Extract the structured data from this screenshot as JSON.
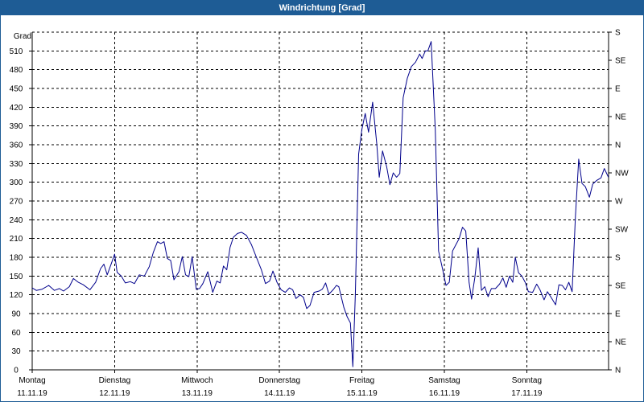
{
  "window": {
    "title": "Windrichtung [Grad]"
  },
  "colors": {
    "titlebar": "#1e5c95",
    "line": "#00008b",
    "grid": "#000000",
    "axis": "#000000"
  },
  "chart_data": {
    "type": "line",
    "title": "Windrichtung [Grad]",
    "ylabel": "Grad",
    "xlabel": "",
    "ylim": [
      0,
      540
    ],
    "yticks": [
      0,
      30,
      60,
      90,
      120,
      150,
      180,
      210,
      240,
      270,
      300,
      330,
      360,
      390,
      420,
      450,
      480,
      510
    ],
    "y2_ticks": [
      {
        "value": 0,
        "label": "N"
      },
      {
        "value": 45,
        "label": "NE"
      },
      {
        "value": 90,
        "label": "E"
      },
      {
        "value": 135,
        "label": "SE"
      },
      {
        "value": 180,
        "label": "S"
      },
      {
        "value": 225,
        "label": "SW"
      },
      {
        "value": 270,
        "label": "W"
      },
      {
        "value": 315,
        "label": "NW"
      },
      {
        "value": 360,
        "label": "N"
      },
      {
        "value": 405,
        "label": "NE"
      },
      {
        "value": 450,
        "label": "E"
      },
      {
        "value": 495,
        "label": "SE"
      },
      {
        "value": 540,
        "label": "S"
      }
    ],
    "xlim": [
      0,
      7.0
    ],
    "x_unit": "days from Monday 11.11.19 00:00",
    "days": [
      {
        "name": "Montag",
        "date": "11.11.19"
      },
      {
        "name": "Dienstag",
        "date": "12.11.19"
      },
      {
        "name": "Mittwoch",
        "date": "13.11.19"
      },
      {
        "name": "Donnerstag",
        "date": "14.11.19"
      },
      {
        "name": "Freitag",
        "date": "15.11.19"
      },
      {
        "name": "Samstag",
        "date": "16.11.19"
      },
      {
        "name": "Sonntag",
        "date": "17.11.19"
      }
    ],
    "grid": true,
    "series": [
      {
        "name": "",
        "points": [
          [
            0.0,
            131
          ],
          [
            0.05,
            127
          ],
          [
            0.12,
            129
          ],
          [
            0.2,
            135
          ],
          [
            0.27,
            127
          ],
          [
            0.33,
            130
          ],
          [
            0.38,
            126
          ],
          [
            0.45,
            133
          ],
          [
            0.5,
            146
          ],
          [
            0.56,
            140
          ],
          [
            0.62,
            136
          ],
          [
            0.7,
            128
          ],
          [
            0.77,
            140
          ],
          [
            0.83,
            162
          ],
          [
            0.87,
            169
          ],
          [
            0.91,
            152
          ],
          [
            0.96,
            170
          ],
          [
            1.0,
            185
          ],
          [
            1.03,
            156
          ],
          [
            1.08,
            150
          ],
          [
            1.13,
            139
          ],
          [
            1.19,
            141
          ],
          [
            1.24,
            138
          ],
          [
            1.3,
            152
          ],
          [
            1.36,
            150
          ],
          [
            1.42,
            165
          ],
          [
            1.47,
            188
          ],
          [
            1.52,
            205
          ],
          [
            1.56,
            202
          ],
          [
            1.6,
            205
          ],
          [
            1.64,
            178
          ],
          [
            1.68,
            175
          ],
          [
            1.72,
            144
          ],
          [
            1.78,
            157
          ],
          [
            1.82,
            181
          ],
          [
            1.86,
            152
          ],
          [
            1.9,
            149
          ],
          [
            1.94,
            181
          ],
          [
            1.99,
            129
          ],
          [
            2.03,
            130
          ],
          [
            2.07,
            138
          ],
          [
            2.13,
            157
          ],
          [
            2.19,
            124
          ],
          [
            2.24,
            142
          ],
          [
            2.28,
            139
          ],
          [
            2.32,
            166
          ],
          [
            2.36,
            160
          ],
          [
            2.4,
            196
          ],
          [
            2.44,
            212
          ],
          [
            2.49,
            218
          ],
          [
            2.54,
            220
          ],
          [
            2.6,
            215
          ],
          [
            2.66,
            200
          ],
          [
            2.72,
            180
          ],
          [
            2.78,
            160
          ],
          [
            2.83,
            138
          ],
          [
            2.88,
            142
          ],
          [
            2.92,
            158
          ],
          [
            2.97,
            140
          ],
          [
            3.02,
            128
          ],
          [
            3.07,
            124
          ],
          [
            3.12,
            131
          ],
          [
            3.16,
            128
          ],
          [
            3.2,
            114
          ],
          [
            3.25,
            120
          ],
          [
            3.29,
            116
          ],
          [
            3.33,
            98
          ],
          [
            3.37,
            103
          ],
          [
            3.42,
            124
          ],
          [
            3.48,
            126
          ],
          [
            3.52,
            129
          ],
          [
            3.56,
            139
          ],
          [
            3.6,
            121
          ],
          [
            3.65,
            128
          ],
          [
            3.69,
            135
          ],
          [
            3.72,
            133
          ],
          [
            3.78,
            100
          ],
          [
            3.82,
            85
          ],
          [
            3.86,
            75
          ],
          [
            3.89,
            5
          ],
          [
            3.92,
            120
          ],
          [
            3.96,
            345
          ],
          [
            4.0,
            385
          ],
          [
            4.04,
            410
          ],
          [
            4.08,
            380
          ],
          [
            4.13,
            428
          ],
          [
            4.18,
            362
          ],
          [
            4.21,
            308
          ],
          [
            4.25,
            350
          ],
          [
            4.3,
            325
          ],
          [
            4.34,
            296
          ],
          [
            4.38,
            315
          ],
          [
            4.42,
            308
          ],
          [
            4.46,
            314
          ],
          [
            4.5,
            435
          ],
          [
            4.55,
            466
          ],
          [
            4.6,
            485
          ],
          [
            4.65,
            492
          ],
          [
            4.7,
            505
          ],
          [
            4.73,
            498
          ],
          [
            4.77,
            510
          ],
          [
            4.8,
            510
          ],
          [
            4.84,
            525
          ],
          [
            4.89,
            385
          ],
          [
            4.93,
            190
          ],
          [
            4.98,
            160
          ],
          [
            5.02,
            135
          ],
          [
            5.06,
            140
          ],
          [
            5.1,
            190
          ],
          [
            5.14,
            200
          ],
          [
            5.18,
            210
          ],
          [
            5.22,
            228
          ],
          [
            5.26,
            222
          ],
          [
            5.3,
            140
          ],
          [
            5.33,
            113
          ],
          [
            5.37,
            148
          ],
          [
            5.41,
            195
          ],
          [
            5.45,
            127
          ],
          [
            5.49,
            133
          ],
          [
            5.53,
            117
          ],
          [
            5.57,
            130
          ],
          [
            5.62,
            130
          ],
          [
            5.67,
            137
          ],
          [
            5.71,
            147
          ],
          [
            5.75,
            132
          ],
          [
            5.79,
            150
          ],
          [
            5.83,
            140
          ],
          [
            5.86,
            180
          ],
          [
            5.9,
            155
          ],
          [
            5.94,
            150
          ],
          [
            5.98,
            140
          ],
          [
            6.02,
            125
          ],
          [
            6.07,
            124
          ],
          [
            6.12,
            137
          ],
          [
            6.16,
            128
          ],
          [
            6.21,
            112
          ],
          [
            6.25,
            125
          ],
          [
            6.3,
            115
          ],
          [
            6.35,
            104
          ],
          [
            6.39,
            136
          ],
          [
            6.43,
            135
          ],
          [
            6.47,
            128
          ],
          [
            6.51,
            140
          ],
          [
            6.55,
            125
          ],
          [
            6.59,
            245
          ],
          [
            6.63,
            337
          ],
          [
            6.67,
            298
          ],
          [
            6.71,
            293
          ],
          [
            6.76,
            276
          ],
          [
            6.8,
            297
          ],
          [
            6.85,
            303
          ],
          [
            6.9,
            307
          ],
          [
            6.94,
            322
          ],
          [
            6.99,
            308
          ],
          [
            7.03,
            310
          ],
          [
            7.08,
            320
          ],
          [
            7.13,
            322
          ]
        ]
      }
    ]
  }
}
